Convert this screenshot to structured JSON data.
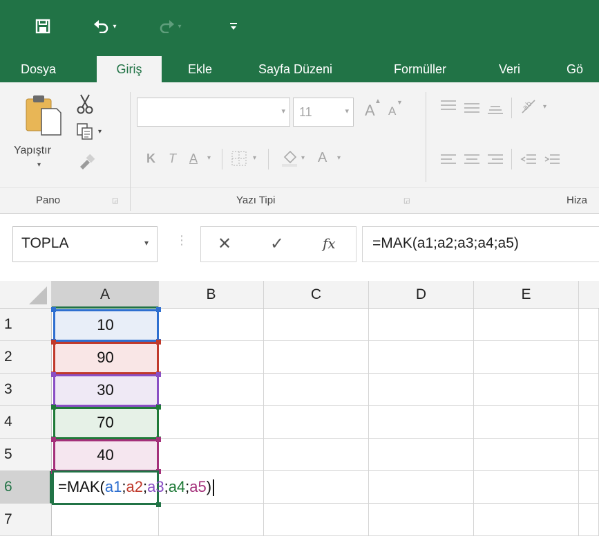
{
  "qat": {
    "save_icon": "save-icon",
    "undo_icon": "undo-icon",
    "redo_icon": "redo-icon",
    "customize_icon": "customize-qat-icon"
  },
  "tabs": [
    "Dosya",
    "Giriş",
    "Ekle",
    "Sayfa Düzeni",
    "Formüller",
    "Veri",
    "Gö"
  ],
  "active_tab": "Giriş",
  "ribbon": {
    "paste_label": "Yapıştır",
    "font_name": "",
    "font_size": "11",
    "bold": "K",
    "italic": "T",
    "underline": "A",
    "grow_font": "A",
    "shrink_font": "A",
    "font_color": "A",
    "groups": {
      "clipboard": "Pano",
      "font": "Yazı Tipi",
      "alignment": "Hiza"
    }
  },
  "formula_bar": {
    "name_box": "TOPLA",
    "cancel_symbol": "✕",
    "enter_symbol": "✓",
    "fx_label": "fx",
    "formula": "=MAK(a1;a2;a3;a4;a5)"
  },
  "sheet": {
    "columns": [
      "A",
      "B",
      "C",
      "D",
      "E"
    ],
    "rows": [
      "1",
      "2",
      "3",
      "4",
      "5",
      "6",
      "7"
    ],
    "values": [
      "10",
      "90",
      "30",
      "70",
      "40"
    ],
    "editing_prefix": "=MAK(",
    "editing_refs": [
      "a1",
      "a2",
      "a3",
      "a4",
      "a5"
    ],
    "editing_sep": ";",
    "editing_suffix": ")",
    "ref_colors": [
      "#2e6fd0",
      "#c0392b",
      "#8a4fc4",
      "#1f7a38",
      "#a4307a"
    ],
    "ref_fills": [
      "#e8eef8",
      "#f9e6e6",
      "#efe9f5",
      "#e6f1e7",
      "#f5e6ef"
    ],
    "active_border": "#217346"
  }
}
